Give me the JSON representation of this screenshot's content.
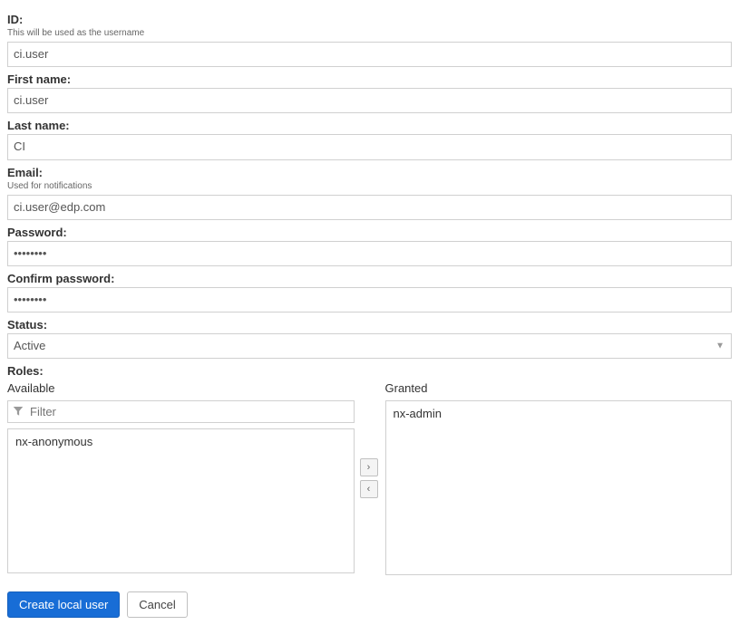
{
  "fields": {
    "id": {
      "label": "ID:",
      "hint": "This will be used as the username",
      "value": "ci.user"
    },
    "firstName": {
      "label": "First name:",
      "value": "ci.user"
    },
    "lastName": {
      "label": "Last name:",
      "value": "CI"
    },
    "email": {
      "label": "Email:",
      "hint": "Used for notifications",
      "value": "ci.user@edp.com"
    },
    "password": {
      "label": "Password:",
      "value": "••••••••"
    },
    "confirmPassword": {
      "label": "Confirm password:",
      "value": "••••••••"
    },
    "status": {
      "label": "Status:",
      "value": "Active"
    }
  },
  "roles": {
    "label": "Roles:",
    "available": {
      "title": "Available",
      "filterPlaceholder": "Filter",
      "items": [
        "nx-anonymous"
      ]
    },
    "granted": {
      "title": "Granted",
      "items": [
        "nx-admin"
      ]
    }
  },
  "buttons": {
    "create": "Create local user",
    "cancel": "Cancel"
  }
}
